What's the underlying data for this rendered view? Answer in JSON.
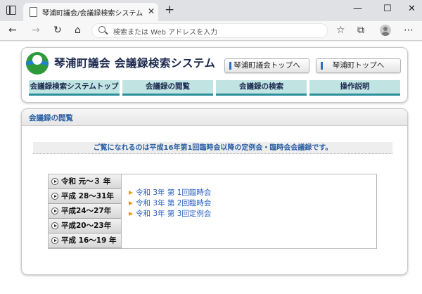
{
  "browser": {
    "tab_title": "琴浦町議会/会議録検索システム",
    "tab_close": "✕",
    "new_tab": "+",
    "window_controls": [
      "—",
      "☐",
      "✕"
    ],
    "address_placeholder": "検索または Web アドレスを入力",
    "nav_icons": [
      "back-icon",
      "forward-icon",
      "reload-icon",
      "home-icon"
    ],
    "toolbar_icons": [
      "favorites-icon",
      "collections-icon",
      "profile-icon",
      "menu-icon"
    ]
  },
  "header": {
    "site_title": "琴浦町議会 会議録検索システム",
    "top_links": [
      "琴浦町議会トップへ",
      "琴浦町トップへ"
    ],
    "nav": [
      "会議録検索システムトップ",
      "会議録の閲覧",
      "会議録の検索",
      "操作説明"
    ]
  },
  "main": {
    "heading": "会議録の閲覧",
    "notice": "ご覧になれるのは平成16年第1回臨時会以降の定例会・臨時会会議録です。",
    "eras": [
      "令和 元～３ 年",
      "平成 28～31年",
      "平成24～27年",
      "平成20～23年",
      "平成 16～19 年"
    ],
    "sessions": [
      "令和 3年 第 1回臨時会",
      "令和 3年 第 2回臨時会",
      "令和 3年 第 3回定例会"
    ]
  },
  "colors": {
    "nav_bg": "#bfe4e2",
    "nav_border": "#2b8f9b",
    "heading_blue": "#2a5fa5",
    "link_blue": "#2a5fc0",
    "arrow_orange": "#e89a16"
  }
}
